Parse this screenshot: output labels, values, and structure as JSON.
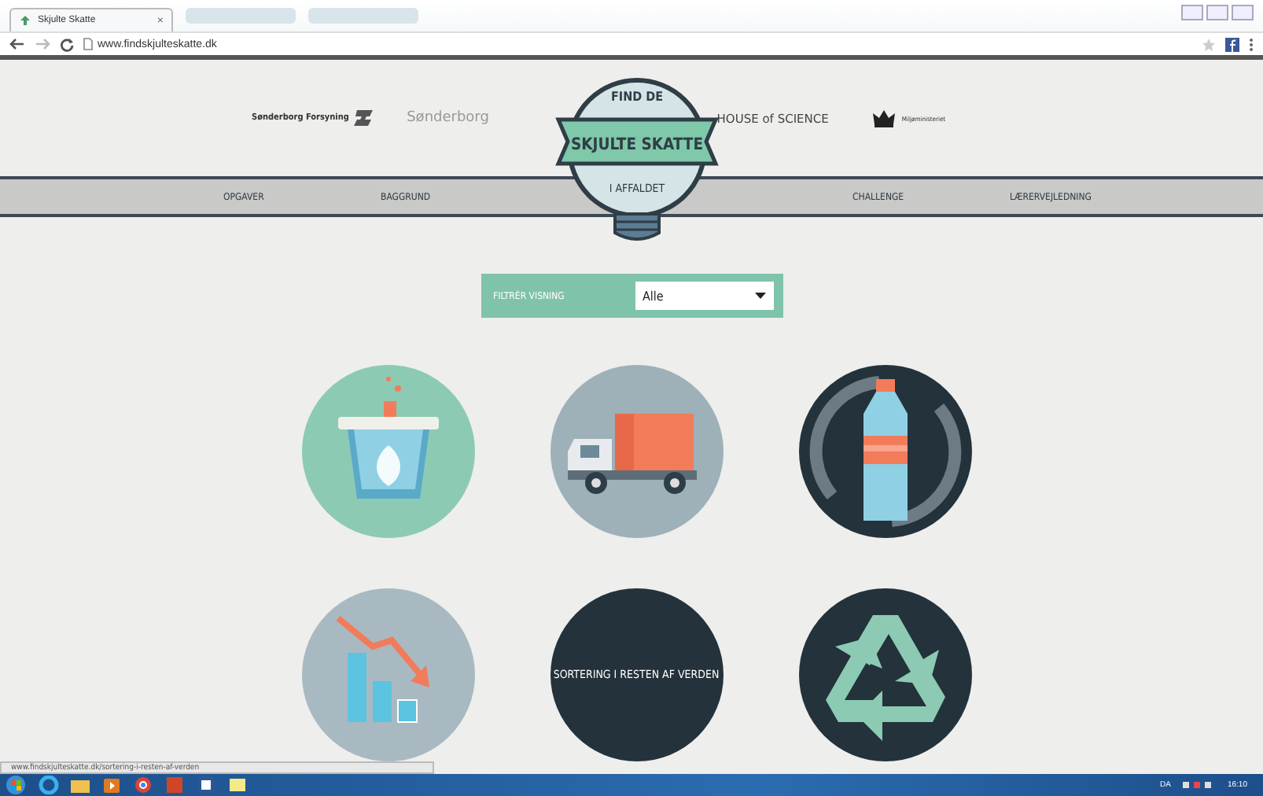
{
  "browser": {
    "tab_title": "Skjulte Skatte",
    "tab_close": "×",
    "url": "www.findskjulteskatte.dk"
  },
  "partners": [
    {
      "kind": "forsyning",
      "name": "Sønderborg Forsyning"
    },
    {
      "kind": "wordmark",
      "name": "Sønderborg"
    },
    {
      "kind": "science",
      "name": "HOUSE of SCIENCE"
    },
    {
      "kind": "crown",
      "name": "Miljøministeriet"
    }
  ],
  "badge": {
    "top": "FIND DE",
    "title": "SKJULTE SKATTE",
    "bottom": "I AFFALDET"
  },
  "nav": [
    "OPGAVER",
    "BAGGRUND",
    "CHALLENGE",
    "LÆRERVEJLEDNING"
  ],
  "filter": {
    "label": "FILTRÉR VISNING",
    "value": "Alle"
  },
  "topics": [
    {
      "kind": "bin",
      "color": "#8dcab3"
    },
    {
      "kind": "truck",
      "color": "#9eb0b8"
    },
    {
      "kind": "bottle",
      "color": "#23323b"
    },
    {
      "kind": "chart",
      "color": "#a9b9c1"
    },
    {
      "kind": "text",
      "color": "#23323b",
      "label": "SORTERING I RESTEN AF VERDEN"
    },
    {
      "kind": "recycle",
      "color": "#23323b"
    }
  ],
  "status_url": "www.findskjulteskatte.dk/sortering-i-resten-af-verden",
  "taskbar": {
    "language": "DA",
    "time": "16:10"
  }
}
